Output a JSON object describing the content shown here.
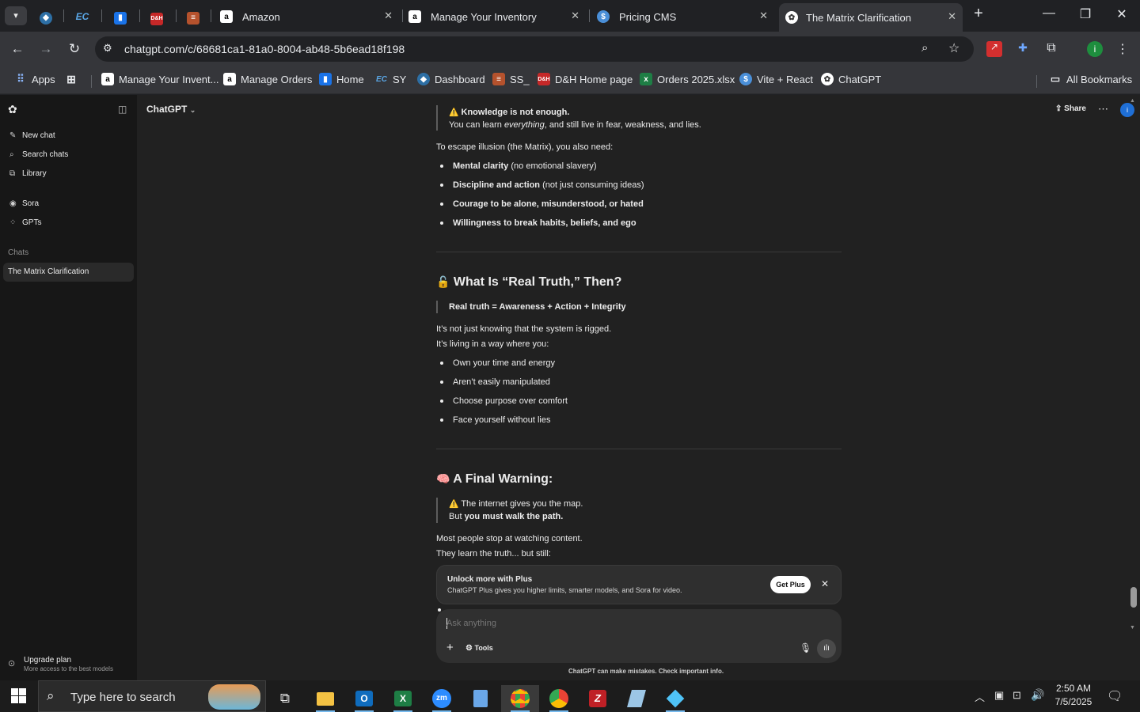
{
  "browser": {
    "tabs": [
      {
        "label": "Amazon"
      },
      {
        "label": "Manage Your Inventory"
      },
      {
        "label": "Pricing CMS"
      },
      {
        "label": "The Matrix Clarification"
      }
    ],
    "pinned_badge": "EC",
    "url": "chatgpt.com/c/68681ca1-81a0-8004-ab48-5b6ead18f198",
    "profile_initial": "i",
    "bookmarks": [
      {
        "label": "Apps"
      },
      {
        "label": "Manage Your Invent..."
      },
      {
        "label": "Manage Orders"
      },
      {
        "label": "Home"
      },
      {
        "label": "SY",
        "badge": "EC"
      },
      {
        "label": "Dashboard"
      },
      {
        "label": "SS_"
      },
      {
        "label": "D&H Home page"
      },
      {
        "label": "Orders 2025.xlsx"
      },
      {
        "label": "Vite + React"
      },
      {
        "label": "ChatGPT"
      },
      {
        "label": "All Bookmarks"
      }
    ]
  },
  "sidebar": {
    "new_chat": "New chat",
    "search_chats": "Search chats",
    "library": "Library",
    "sora": "Sora",
    "gpts": "GPTs",
    "chats_heading": "Chats",
    "active_chat": "The Matrix Clarification",
    "upgrade_title": "Upgrade plan",
    "upgrade_sub": "More access to the best models"
  },
  "header": {
    "model": "ChatGPT",
    "share": "Share",
    "avatar_initial": "i"
  },
  "content": {
    "q1_line1_prefix": "⚠️",
    "q1_line1": "Knowledge is not enough.",
    "q1_line2_a": "You can learn ",
    "q1_line2_em": "everything",
    "q1_line2_b": ", and still live in fear, weakness, and lies.",
    "escape_intro": "To escape illusion (the Matrix), you also need:",
    "needs": [
      {
        "bold": "Mental clarity",
        "rest": " (no emotional slavery)"
      },
      {
        "bold": "Discipline and action",
        "rest": " (not just consuming ideas)"
      },
      {
        "bold": "Courage to be alone, misunderstood, or hated",
        "rest": ""
      },
      {
        "bold": "Willingness to break habits, beliefs, and ego",
        "rest": ""
      }
    ],
    "h_truth_emoji": "🔓",
    "h_truth": "What Is “Real Truth,” Then?",
    "truth_quote": "Real truth = Awareness + Action + Integrity",
    "truth_p1": "It’s not just knowing that the system is rigged.",
    "truth_p2": "It’s living in a way where you:",
    "truth_list": [
      "Own your time and energy",
      "Aren’t easily manipulated",
      "Choose purpose over comfort",
      "Face yourself without lies"
    ],
    "h_warning_emoji": "🧠",
    "h_warning": "A Final Warning:",
    "warn_q1": "The internet gives you the map.",
    "warn_q2_a": "But ",
    "warn_q2_b": "you must walk the path.",
    "warn_p1": "Most people stop at watching content.",
    "warn_p2": "They learn the truth... but still:"
  },
  "promo": {
    "title": "Unlock more with Plus",
    "body": "ChatGPT Plus gives you higher limits, smarter models, and Sora for video.",
    "button": "Get Plus"
  },
  "composer": {
    "placeholder": "Ask anything",
    "tools": "Tools"
  },
  "disclaimer": "ChatGPT can make mistakes. Check important info.",
  "taskbar": {
    "search_placeholder": "Type here to search",
    "time": "2:50 AM",
    "date": "7/5/2025"
  }
}
